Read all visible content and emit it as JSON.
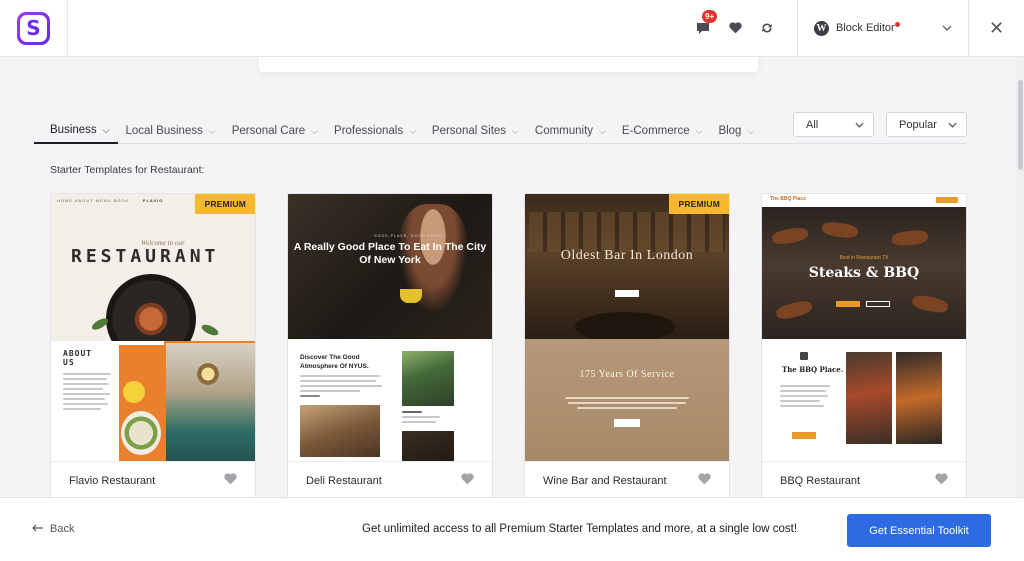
{
  "header": {
    "logo_letter": "S",
    "notification_badge": "9+",
    "editor_label": "Block Editor",
    "close_glyph": "✕"
  },
  "search": {
    "partial_text": "Restaurant"
  },
  "categories": [
    {
      "label": "Business",
      "active": true
    },
    {
      "label": "Local Business"
    },
    {
      "label": "Personal Care"
    },
    {
      "label": "Professionals"
    },
    {
      "label": "Personal Sites"
    },
    {
      "label": "Community"
    },
    {
      "label": "E-Commerce"
    },
    {
      "label": "Blog"
    }
  ],
  "filters": {
    "type_selected": "All",
    "sort_selected": "Popular"
  },
  "section_title": "Starter Templates for Restaurant:",
  "premium_label": "PREMIUM",
  "cards": [
    {
      "name": "Flavio Restaurant",
      "premium": true,
      "thumb": {
        "nav": "HOME  ABOUT  MENU  BOOK",
        "logo": "FLAVIO",
        "script": "Welcome to our",
        "title": "RESTAURANT",
        "about": "ABOUT\nUS"
      }
    },
    {
      "name": "Deli Restaurant",
      "premium": false,
      "thumb": {
        "sub": "GOOD PLACE, GOOD FOOD",
        "headline": "A Really Good Place To Eat In The City Of New York",
        "h2": "Discover The Good Atmosphere Of NYUS."
      }
    },
    {
      "name": "Wine Bar and Restaurant",
      "premium": true,
      "thumb": {
        "title": "Oldest Bar In London",
        "h2": "175 Years Of Service"
      }
    },
    {
      "name": "BBQ Restaurant",
      "premium": false,
      "thumb": {
        "logo": "The BBQ Place",
        "script": "Best in Restaurant TX",
        "title": "Steaks & BBQ",
        "h2": "The BBQ Place."
      }
    }
  ],
  "footer": {
    "back_label": "Back",
    "promo_text": "Get unlimited access to all Premium Starter Templates and more, at a single low cost!",
    "cta_label": "Get Essential Toolkit"
  },
  "colors": {
    "accent": "#2d6be3",
    "premium": "#f5b82e",
    "badge": "#e5322d",
    "logo_gradient": [
      "#a23cf0",
      "#5b2ee8"
    ]
  }
}
